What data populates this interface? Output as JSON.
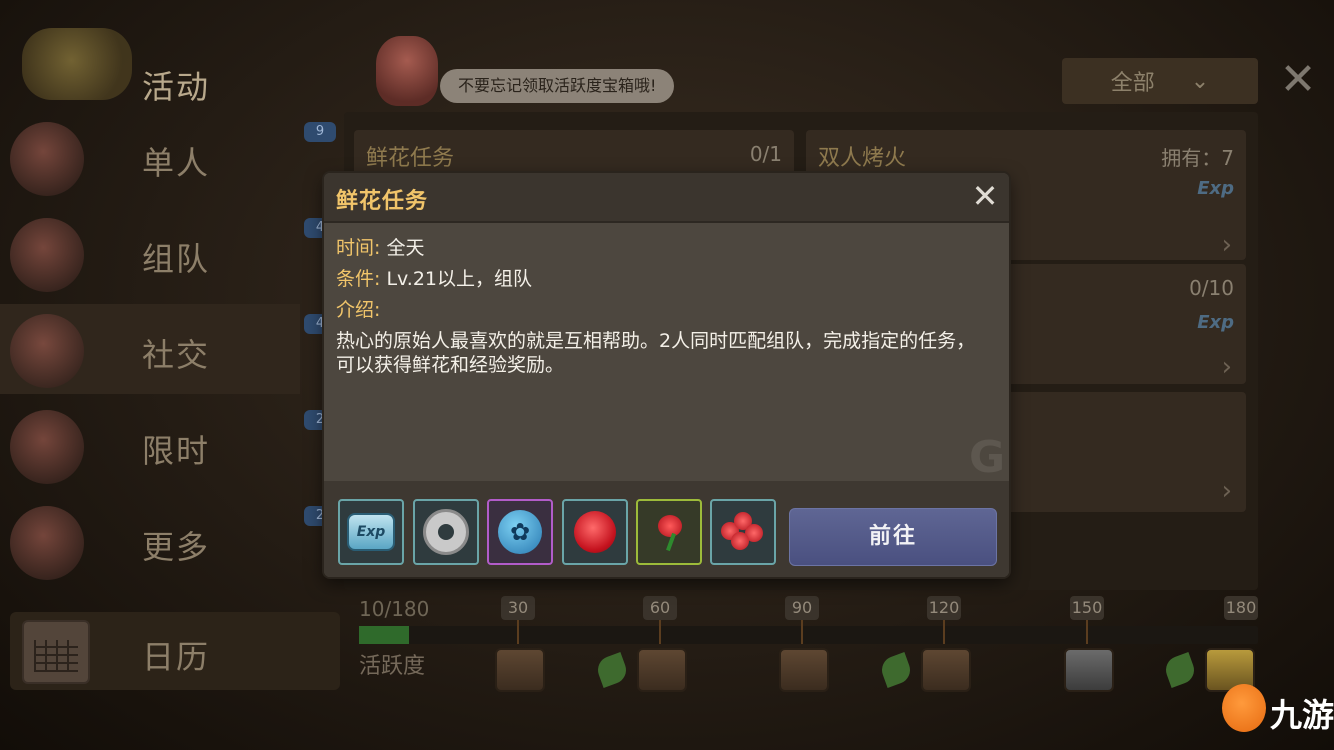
{
  "header": {
    "section_title": "活动",
    "npc_tip": "不要忘记领取活跃度宝箱哦!",
    "filter_label": "全部",
    "close_symbol": "✕"
  },
  "sidebar": {
    "items": [
      {
        "label": "单人",
        "count": "9"
      },
      {
        "label": "组队",
        "count": "4"
      },
      {
        "label": "社交",
        "count": "4"
      },
      {
        "label": "限时",
        "count": "2"
      },
      {
        "label": "更多",
        "count": "2"
      }
    ],
    "calendar_label": "日历"
  },
  "cards": [
    {
      "title": "鲜花任务",
      "right": "0/1"
    },
    {
      "title": "双人烤火",
      "right": "拥有：7",
      "exp": "Exp"
    },
    {
      "right": "0/10",
      "exp": "Exp"
    }
  ],
  "activity": {
    "current": "10/180",
    "label": "活跃度",
    "progress": 0.056,
    "milestones": [
      "30",
      "60",
      "90",
      "120",
      "150",
      "180"
    ]
  },
  "modal": {
    "title": "鲜花任务",
    "time_key": "时间:",
    "time_value": "全天",
    "condition_key": "条件:",
    "condition_value": "Lv.21以上，组队",
    "intro_key": "介绍:",
    "description": "热心的原始人最喜欢的就是互相帮助。2人同时匹配组队，完成指定的任务，可以获得鲜花和经验奖励。",
    "rewards": [
      {
        "icon": "exp-icon",
        "label": "Exp"
      },
      {
        "icon": "ring-icon"
      },
      {
        "icon": "paw-orb-icon"
      },
      {
        "icon": "rose-icon"
      },
      {
        "icon": "single-rose-icon"
      },
      {
        "icon": "bouquet-icon"
      }
    ],
    "go_button": "前往"
  },
  "watermark": {
    "site_text": "九游"
  }
}
